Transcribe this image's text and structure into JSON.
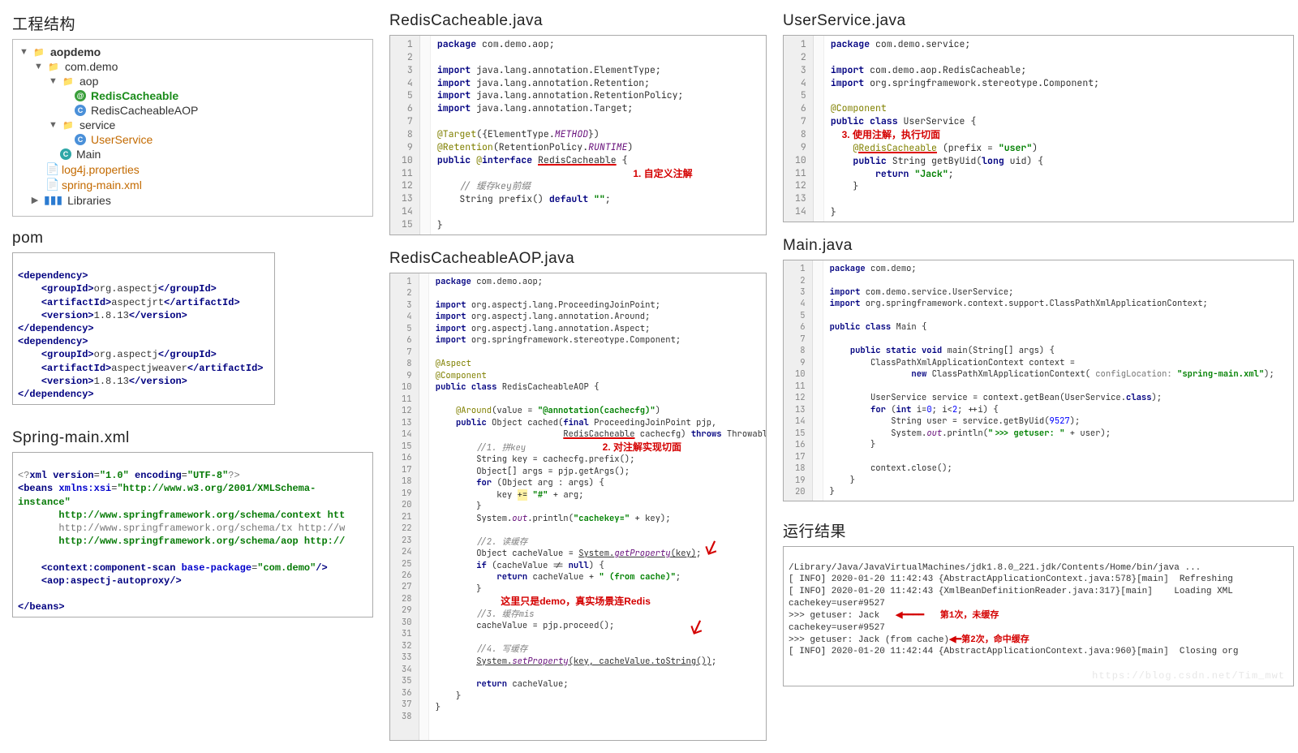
{
  "titles": {
    "tree": "工程结构",
    "redis": "RedisCacheable.java",
    "user": "UserService.java",
    "aop": "RedisCacheableAOP.java",
    "main": "Main.java",
    "pom": "pom",
    "spring": "Spring-main.xml",
    "result": "运行结果"
  },
  "tree": {
    "root": "aopdemo",
    "pkg": "com.demo",
    "aop": "aop",
    "rc": "RedisCacheable",
    "rcaop": "RedisCacheableAOP",
    "svc": "service",
    "usvc": "UserService",
    "mainc": "Main",
    "log4j": "log4j.properties",
    "springxml": "spring-main.xml",
    "libs": "Libraries"
  },
  "pom": "<dependency>\n    <groupId>org.aspectj</groupId>\n    <artifactId>aspectjrt</artifactId>\n    <version>1.8.13</version>\n</dependency>\n<dependency>\n    <groupId>org.aspectj</groupId>\n    <artifactId>aspectjweaver</artifactId>\n    <version>1.8.13</version>\n</dependency>",
  "spring": "<?xml version=\"1.0\" encoding=\"UTF-8\"?>\n<beans xmlns:xsi=\"http://www.w3.org/2001/XMLSchema-instance\"\n       http://www.springframework.org/schema/context htt\n       http://www.springframework.org/schema/tx http://w\n       http://www.springframework.org/schema/aop http://\n\n    <context:component-scan base-package=\"com.demo\"/>\n    <aop:aspectj-autoproxy/>\n\n</beans>",
  "redis": {
    "lines": 15,
    "note1": "1. 自定义注解"
  },
  "user": {
    "lines": 14,
    "note3": "3. 使用注解，执行切面"
  },
  "aop": {
    "lines": 38,
    "note2": "2. 对注解实现切面",
    "note_demo": "这里只是demo，真实场景连Redis"
  },
  "main": {
    "lines": 20
  },
  "result": {
    "l1": "/Library/Java/JavaVirtualMachines/jdk1.8.0_221.jdk/Contents/Home/bin/java ...",
    "l2": "[ INFO] 2020-01-20 11:42:43 {AbstractApplicationContext.java:578}[main]  Refreshing",
    "l3": "[ INFO] 2020-01-20 11:42:43 {XmlBeanDefinitionReader.java:317}[main]    Loading XML",
    "l4": "cachekey=user#9527",
    "l5": ">>> getuser: Jack",
    "l6": "cachekey=user#9527",
    "l7": ">>> getuser: Jack (from cache)",
    "l8": "[ INFO] 2020-01-20 11:42:44 {AbstractApplicationContext.java:960}[main]  Closing org",
    "note1": "第1次，未缓存",
    "note2": "第2次，命中缓存"
  },
  "watermark": "https://blog.csdn.net/Tim_mwt"
}
